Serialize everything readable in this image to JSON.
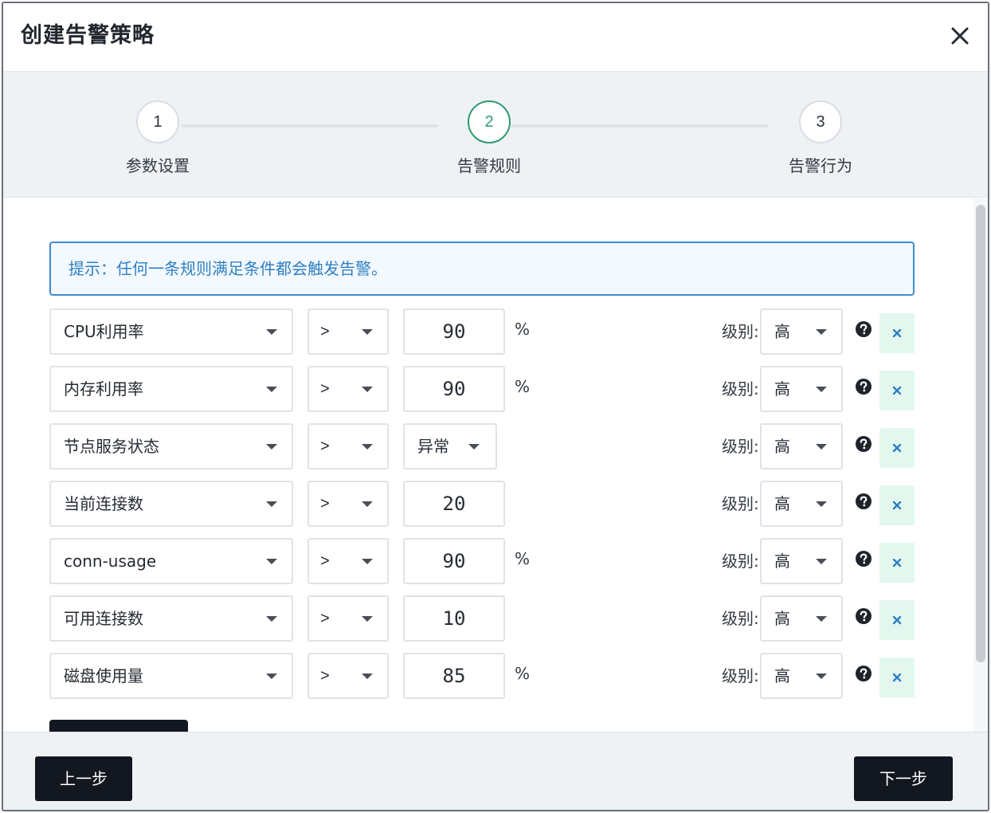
{
  "dialog": {
    "title": "创建告警策略"
  },
  "steps": [
    {
      "number": "1",
      "label": "参数设置",
      "state": "done"
    },
    {
      "number": "2",
      "label": "告警规则",
      "state": "active"
    },
    {
      "number": "3",
      "label": "告警行为",
      "state": "pending"
    }
  ],
  "hint": "提示：任何一条规则满足条件都会触发告警。",
  "level_label": "级别:",
  "rules": [
    {
      "metric": "CPU利用率",
      "operator": ">",
      "value": "90",
      "unit": "%",
      "level": "高"
    },
    {
      "metric": "内存利用率",
      "operator": ">",
      "value": "90",
      "unit": "%",
      "level": "高"
    },
    {
      "metric": "节点服务状态",
      "operator": ">",
      "state": "异常",
      "unit": "",
      "level": "高"
    },
    {
      "metric": "当前连接数",
      "operator": ">",
      "value": "20",
      "unit": "",
      "level": "高"
    },
    {
      "metric": "conn-usage",
      "operator": ">",
      "value": "90",
      "unit": "%",
      "level": "高"
    },
    {
      "metric": "可用连接数",
      "operator": ">",
      "value": "10",
      "unit": "",
      "level": "高"
    },
    {
      "metric": "磁盘使用量",
      "operator": ">",
      "value": "85",
      "unit": "%",
      "level": "高"
    }
  ],
  "footer": {
    "prev_label": "上一步",
    "next_label": "下一步"
  },
  "colors": {
    "accent_green": "#2e9a6d",
    "hint_blue": "#2f7fc4",
    "button_dark": "#131820",
    "delete_bg": "#e4f7ef"
  }
}
